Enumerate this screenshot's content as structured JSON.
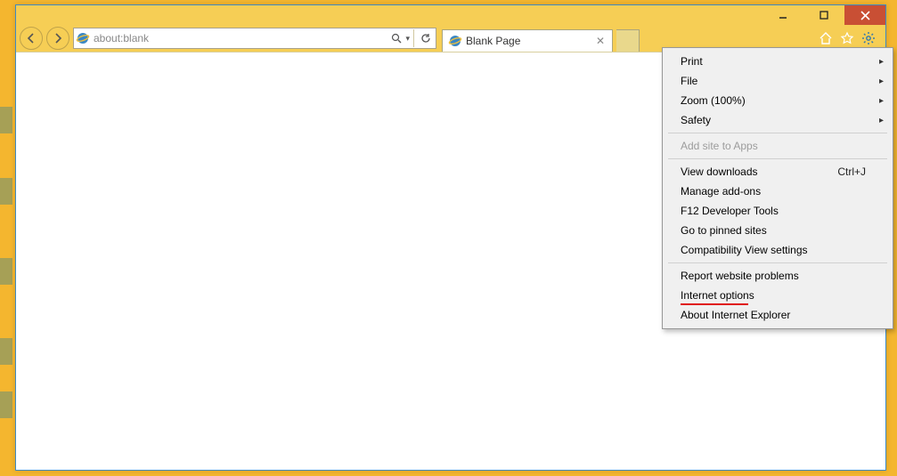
{
  "address_bar": {
    "url": "about:blank",
    "search_placeholder": "",
    "refresh_title": "Refresh"
  },
  "tab": {
    "title": "Blank Page"
  },
  "toolbar_icons": {
    "home": "home-icon",
    "favorites": "star-icon",
    "tools": "gear-icon"
  },
  "tools_menu": {
    "print": "Print",
    "file": "File",
    "zoom": "Zoom (100%)",
    "safety": "Safety",
    "add_site": "Add site to Apps",
    "view_downloads": "View downloads",
    "view_downloads_shortcut": "Ctrl+J",
    "manage_addons": "Manage add-ons",
    "f12": "F12 Developer Tools",
    "pinned": "Go to pinned sites",
    "compat": "Compatibility View settings",
    "report": "Report website problems",
    "internet_options": "Internet options",
    "about": "About Internet Explorer"
  },
  "window_controls": {
    "min": "Minimize",
    "max": "Maximize",
    "close": "Close"
  }
}
